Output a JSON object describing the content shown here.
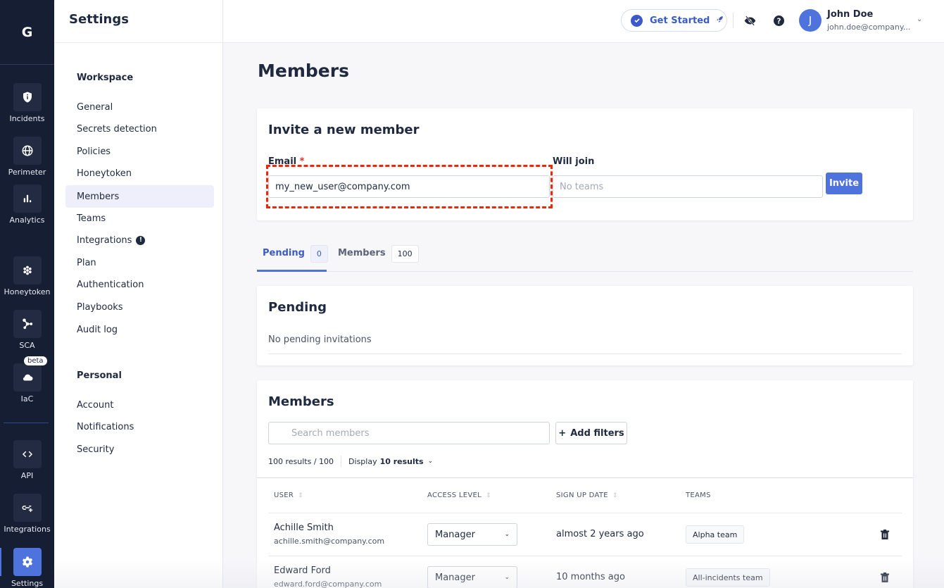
{
  "app": {
    "logo_letter": "G"
  },
  "rail": {
    "items": [
      {
        "label": "Incidents",
        "icon": "shield-icon"
      },
      {
        "label": "Perimeter",
        "icon": "globe-icon"
      },
      {
        "label": "Analytics",
        "icon": "bar-chart-icon"
      },
      {
        "label": "Honeytoken",
        "icon": "honeycomb-icon"
      },
      {
        "label": "SCA",
        "icon": "graph-nodes-icon"
      },
      {
        "label": "IaC",
        "icon": "cloud-icon",
        "badge": "beta"
      },
      {
        "label": "API",
        "icon": "code-icon"
      },
      {
        "label": "Integrations",
        "icon": "link-plus-icon"
      },
      {
        "label": "Settings",
        "icon": "gear-icon",
        "active": true
      }
    ]
  },
  "sidebar": {
    "title": "Settings",
    "workspace_label": "Workspace",
    "workspace_items": [
      "General",
      "Secrets detection",
      "Policies",
      "Honeytoken",
      "Members",
      "Teams",
      "Integrations",
      "Plan",
      "Authentication",
      "Playbooks",
      "Audit log"
    ],
    "active_item": "Members",
    "alert_item": "Integrations",
    "alert_glyph": "!",
    "personal_label": "Personal",
    "personal_items": [
      "Account",
      "Notifications",
      "Security"
    ]
  },
  "topbar": {
    "get_started": "Get Started",
    "user_name": "John Doe",
    "user_email": "john.doe@company...",
    "avatar_letter": "J"
  },
  "main": {
    "title": "Members",
    "invite": {
      "title": "Invite a new member",
      "email_label": "Email",
      "required_mark": "*",
      "email_value": "my_new_user@company.com",
      "join_label": "Will join",
      "join_placeholder": "No teams",
      "invite_button": "Invite"
    },
    "tabs": [
      {
        "label": "Pending",
        "count": "0",
        "active": true
      },
      {
        "label": "Members",
        "count": "100",
        "active": false
      }
    ],
    "pending": {
      "title": "Pending",
      "empty_text": "No pending invitations"
    },
    "members": {
      "title": "Members",
      "search_placeholder": "Search members",
      "add_filters": "Add filters",
      "results_text": "100 results",
      "results_total": "/ 100",
      "display_label": "Display",
      "display_value": "10 results",
      "columns": [
        "USER",
        "ACCESS LEVEL",
        "SIGN UP DATE",
        "TEAMS"
      ],
      "rows": [
        {
          "name": "Achille Smith",
          "email": "achille.smith@company.com",
          "access": "Manager",
          "signup": "almost 2 years ago",
          "team": "Alpha team"
        },
        {
          "name": "Edward Ford",
          "email": "edward.ford@company.com",
          "access": "Manager",
          "signup": "10 months ago",
          "team": "All-incidents team"
        }
      ]
    }
  },
  "colors": {
    "accent": "#4f73dd",
    "rail_bg": "#161e33",
    "highlight": "#e8290c"
  }
}
